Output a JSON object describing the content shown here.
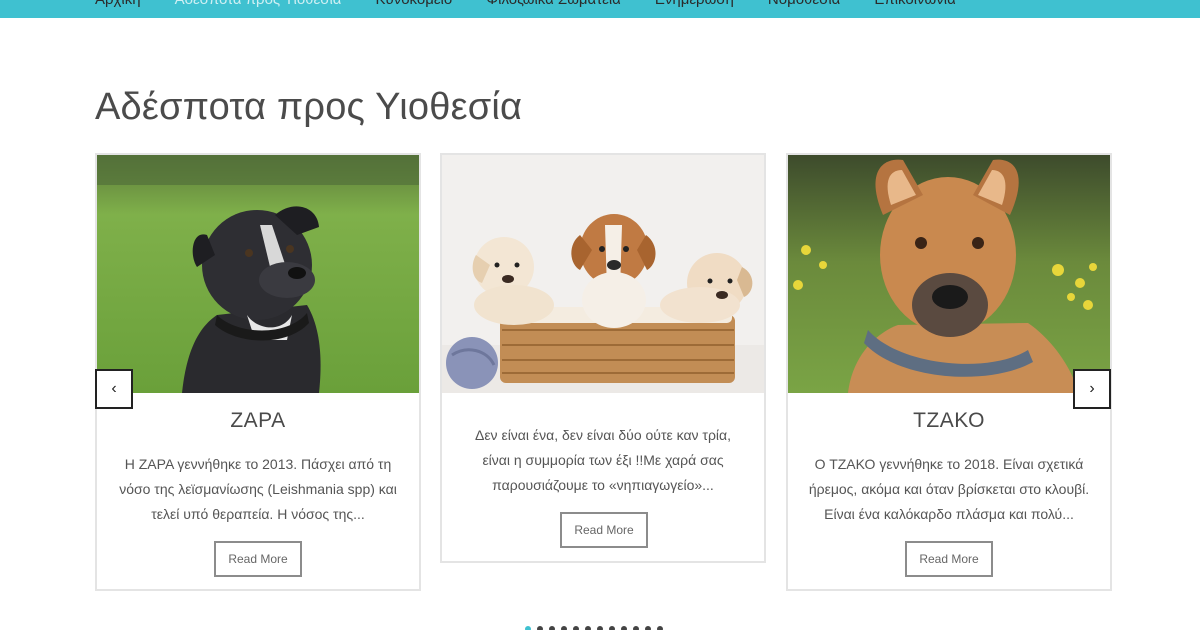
{
  "nav": {
    "items": [
      {
        "label": "Αρχική",
        "active": false
      },
      {
        "label": "Αδέσποτα προς Υιοθεσία",
        "active": true
      },
      {
        "label": "Κυνοκομείο",
        "active": false
      },
      {
        "label": "Φιλοζωικά Σωματεία",
        "active": false
      },
      {
        "label": "Ενημέρωση",
        "active": false
      },
      {
        "label": "Νομοθεσία",
        "active": false
      },
      {
        "label": "Επικοινωνία",
        "active": false
      }
    ]
  },
  "page": {
    "title": "Αδέσποτα προς Υιοθεσία"
  },
  "cards": [
    {
      "title": "ΖΑΡΑ",
      "description": "Η ΖΑΡΑ γεννήθηκε το 2013. Πάσχει από τη νόσο της λεϊσμανίωσης (Leishmania spp) και τελεί υπό θεραπεία. Η νόσος της...",
      "button": "Read More",
      "image": "black-dog-photo"
    },
    {
      "title": "",
      "description": "Δεν είναι ένα, δεν είναι δύο ούτε καν τρία, είναι η συμμορία των έξι !!Με χαρά σας παρουσιάζουμε το «νηπιαγωγείο»...",
      "button": "Read More",
      "image": "puppies-in-basket-photo"
    },
    {
      "title": "ΤΖΑΚΟ",
      "description": "Ο ΤΖΑΚΟ γεννήθηκε το 2018. Είναι σχετικά ήρεμος, ακόμα και όταν βρίσκεται στο κλουβί. Είναι ένα καλόκαρδο πλάσμα και πολύ...",
      "button": "Read More",
      "image": "brown-dog-photo"
    }
  ],
  "carousel": {
    "prev": "‹",
    "next": "›",
    "dot_count": 12,
    "active_dot": 0
  },
  "colors": {
    "accent": "#3fc1d0",
    "nav_text": "#2b2b2b"
  }
}
